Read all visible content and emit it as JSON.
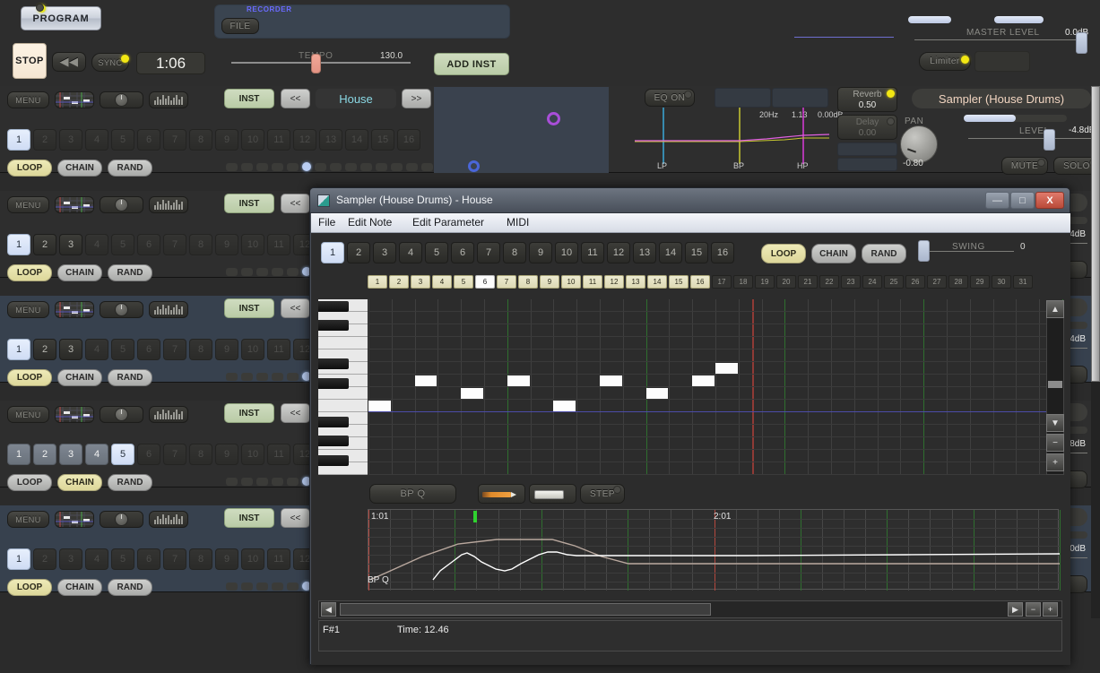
{
  "transport": {
    "program_label": "PROGRAM",
    "recorder_label": "RECORDER",
    "file_label": "FILE",
    "stop_label": "STOP",
    "rewind_icon": "rewind-icon",
    "sync_label": "SYNC",
    "time": "1:06",
    "tempo_label": "TEMPO",
    "tempo_value": "130.0",
    "add_inst_label": "ADD INST"
  },
  "master": {
    "level_label": "MASTER LEVEL",
    "level_value": "0.0dB",
    "limiter_label": "Limiter"
  },
  "tracks": [
    {
      "menu": "MENU",
      "inst": "INST",
      "prev": "<<",
      "name": "House",
      "next": ">>",
      "pattern_count": 16,
      "active_through": 0,
      "selected": 1,
      "mode": "LOOP",
      "theme": "dark",
      "seq_dot": 5,
      "eq_on": "EQ ON",
      "eq_freq": "20Hz",
      "eq_q": "1.13",
      "eq_gain": "0.00dB",
      "eq_lp": "LP",
      "eq_bp": "BP",
      "eq_hp": "HP",
      "reverb_label": "Reverb",
      "reverb_value": "0.50",
      "delay_label": "Delay",
      "delay_value": "0.00",
      "pan_label": "PAN",
      "pan_value": "-0.80",
      "inst_name": "Sampler (House Drums)",
      "level_label": "LEVEL",
      "level_value": "-4.8dB",
      "mute": "MUTE",
      "solo": "SOLO"
    },
    {
      "menu": "MENU",
      "inst": "INST",
      "prev": "<<",
      "pattern_count": 16,
      "active_through": 3,
      "selected": 1,
      "mode": "LOOP",
      "theme": "dark",
      "seq_dot": 5,
      "level_value": "-4dB"
    },
    {
      "menu": "MENU",
      "inst": "INST",
      "prev": "<<",
      "pattern_count": 16,
      "active_through": 3,
      "selected": 1,
      "mode": "LOOP",
      "theme": "blue",
      "seq_dot": 5,
      "level_value": "-4dB"
    },
    {
      "menu": "MENU",
      "inst": "INST",
      "prev": "<<",
      "pattern_count": 16,
      "active_through": 5,
      "selected": 5,
      "mode": "CHAIN",
      "theme": "dark",
      "seq_dot": 5,
      "level_value": "-8dB"
    },
    {
      "menu": "MENU",
      "inst": "INST",
      "prev": "<<",
      "pattern_count": 16,
      "active_through": 1,
      "selected": 1,
      "mode": "LOOP",
      "theme": "blue",
      "seq_dot": 5,
      "level_value": "-0dB"
    }
  ],
  "track_mode_buttons": [
    "LOOP",
    "CHAIN",
    "RAND"
  ],
  "sampler": {
    "title": "Sampler (House Drums) - House",
    "window_buttons": {
      "minimize": "—",
      "maximize": "□",
      "close": "X"
    },
    "menus": [
      "File",
      "Edit Note",
      "Edit Parameter",
      "MIDI"
    ],
    "patterns": [
      "1",
      "2",
      "3",
      "4",
      "5",
      "6",
      "7",
      "8",
      "9",
      "10",
      "11",
      "12",
      "13",
      "14",
      "15",
      "16"
    ],
    "pattern_selected": "1",
    "modes": [
      "LOOP",
      "CHAIN",
      "RAND"
    ],
    "mode_active": "LOOP",
    "swing_label": "SWING",
    "swing_value": "0",
    "bars": [
      "1",
      "2",
      "3",
      "4",
      "5",
      "6",
      "7",
      "8",
      "9",
      "10",
      "11",
      "12",
      "13",
      "14",
      "15",
      "16",
      "17",
      "18",
      "19",
      "20",
      "21",
      "22",
      "23",
      "24",
      "25",
      "26",
      "27",
      "28",
      "29",
      "30",
      "31"
    ],
    "bars_active_through": 16,
    "bar_selected": "6",
    "parameter_label": "BP Q",
    "tool_pencil": "pencil-icon",
    "tool_eraser": "eraser-icon",
    "step_label": "STEP",
    "lane_bar_labels": [
      "1:01",
      "2:01"
    ],
    "lane_param_name": "BP Q",
    "status_note": "F#1",
    "status_time": "Time: 12.46",
    "scroll_up": "▲",
    "scroll_down": "▼",
    "zoom_out": "−",
    "zoom_in": "+",
    "hscroll_left": "◀",
    "hscroll_right": "▶"
  },
  "colors": {
    "accent_green": "#b9cba6",
    "accent_cream": "#ddd79a",
    "led_yellow": "#f2e713",
    "track_name": "#8ad8e4",
    "inst_name": "#f0d4c0",
    "note_white": "#fdfdfd",
    "playhead_red": "#b5483f",
    "bar_green": "#2f6f2f"
  },
  "piano_roll": {
    "notes": [
      {
        "col": 0,
        "row": 8
      },
      {
        "col": 2,
        "row": 6
      },
      {
        "col": 4,
        "row": 7
      },
      {
        "col": 6,
        "row": 6
      },
      {
        "col": 8,
        "row": 8
      },
      {
        "col": 10,
        "row": 6
      },
      {
        "col": 12,
        "row": 7
      },
      {
        "col": 14,
        "row": 6
      },
      {
        "col": 15,
        "row": 5
      }
    ],
    "root_note": "F#1"
  }
}
